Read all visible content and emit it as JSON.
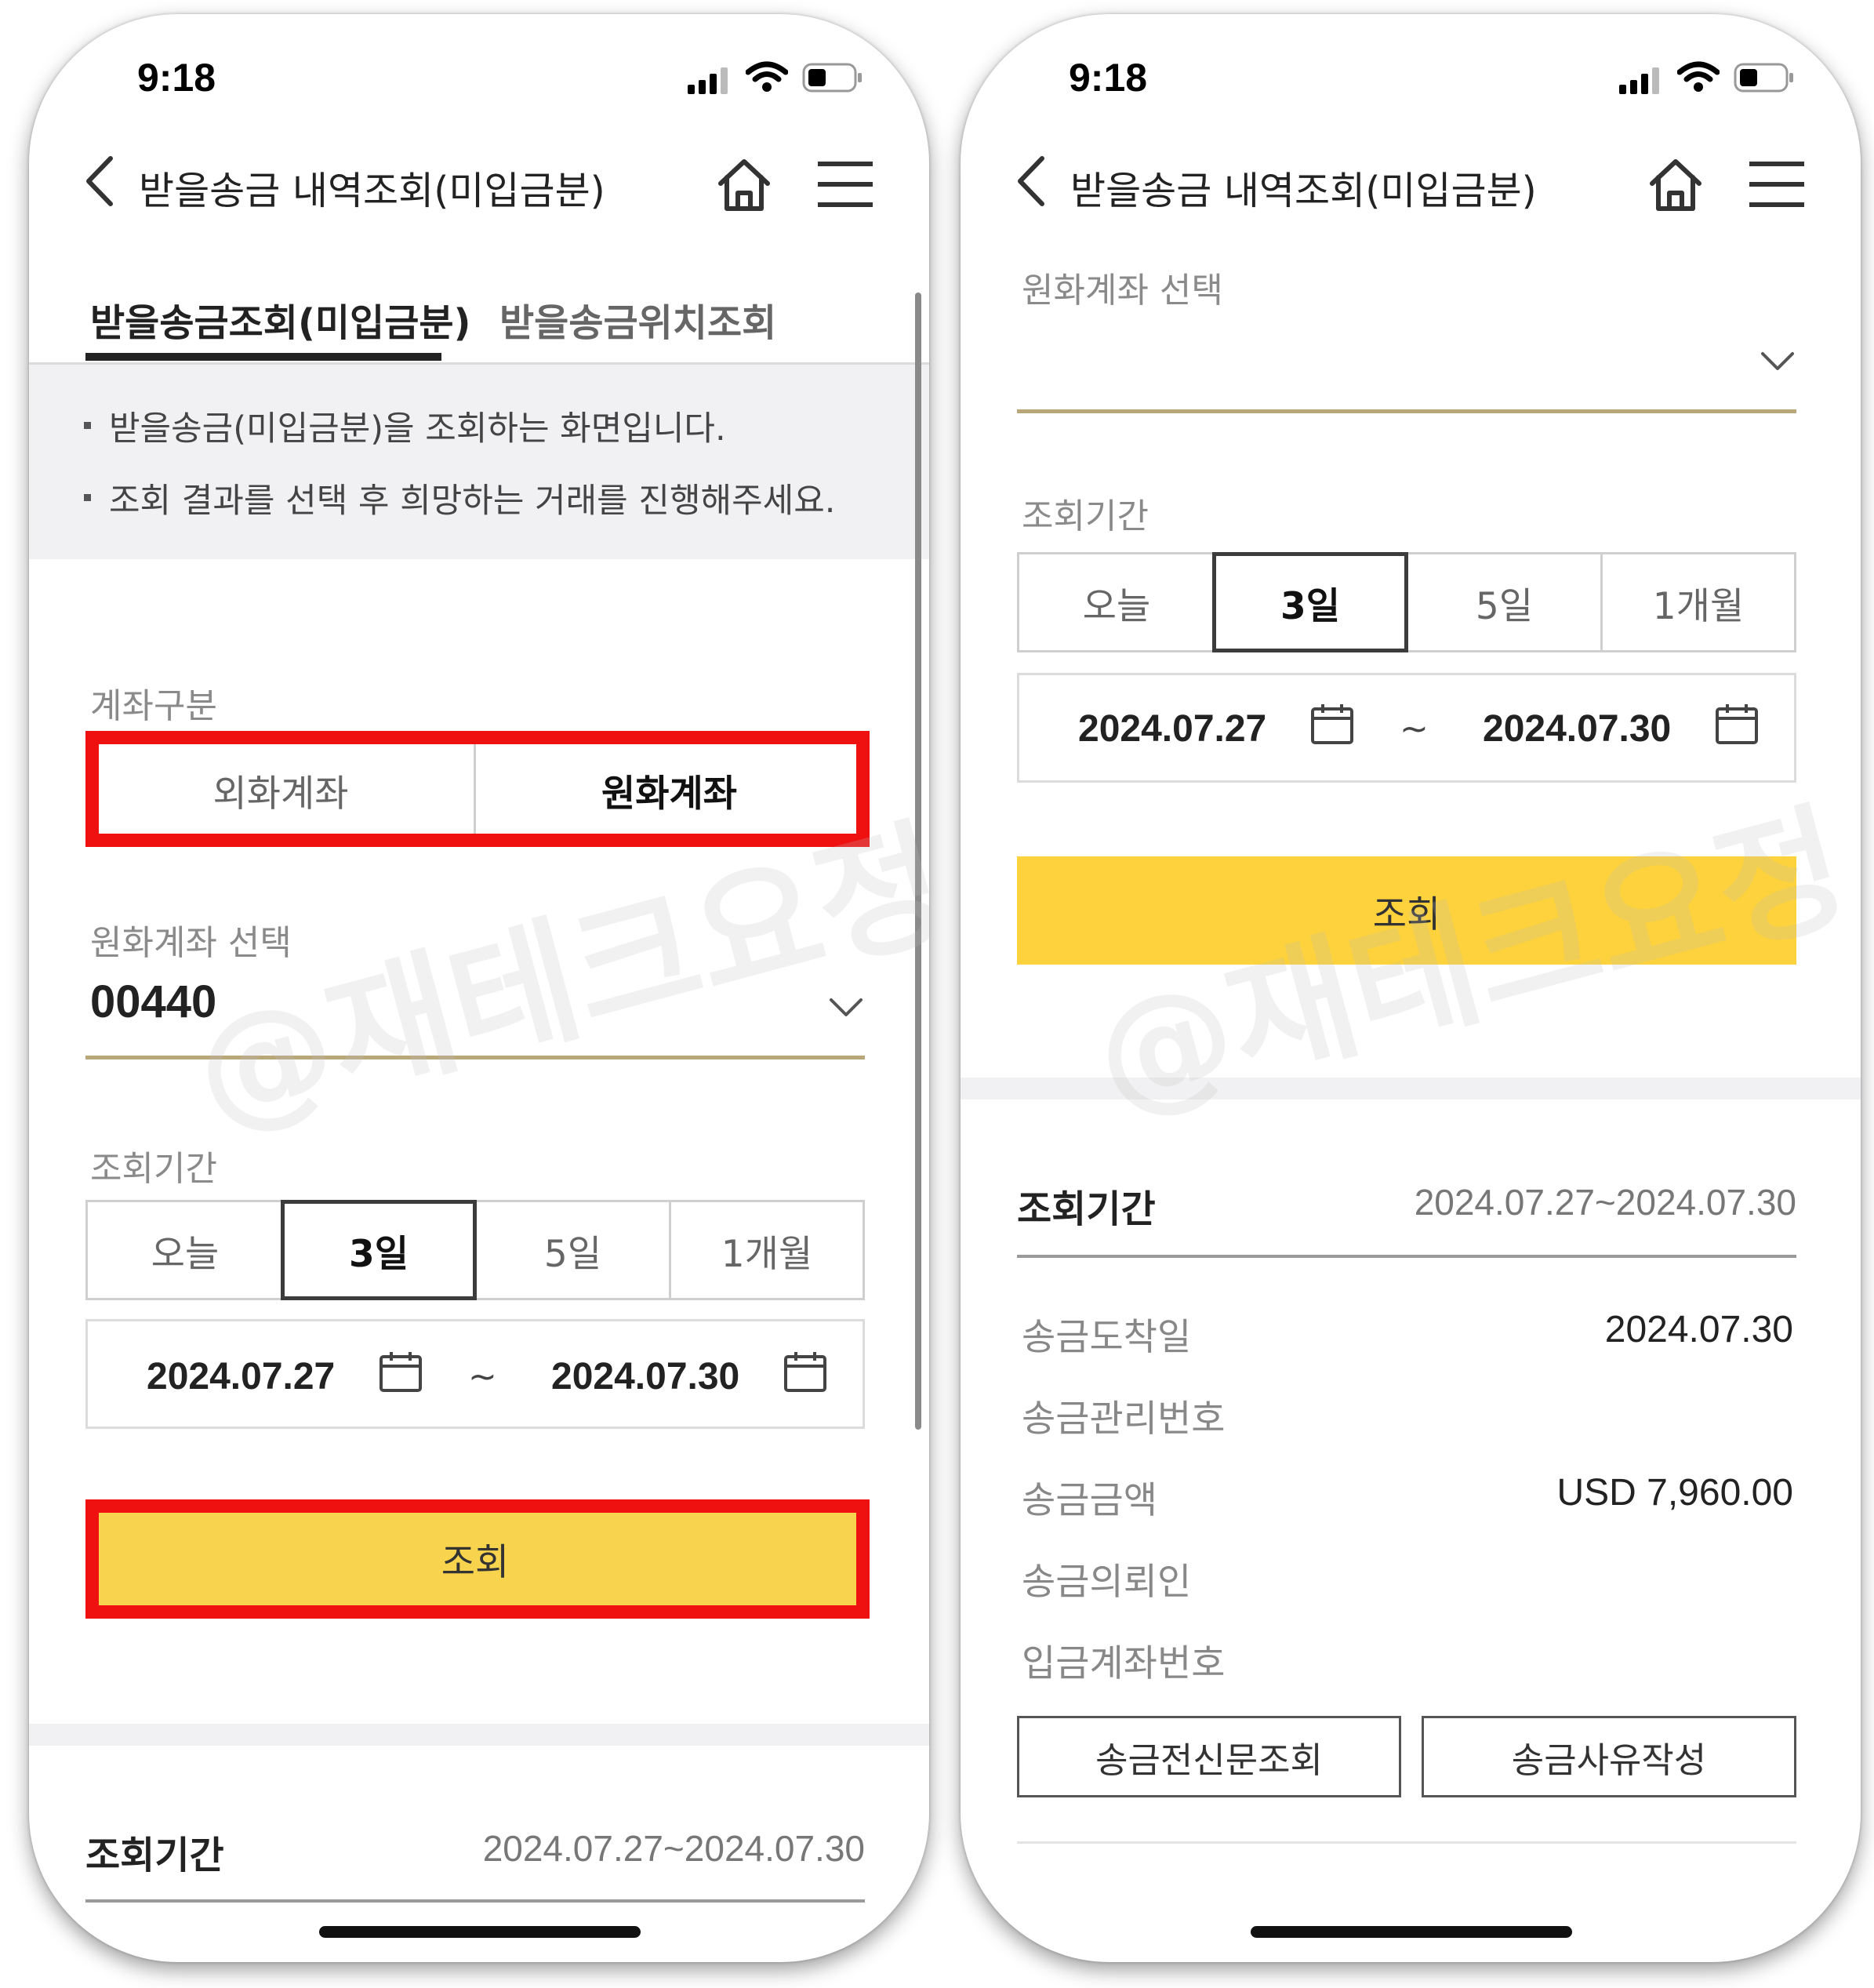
{
  "status_bar": {
    "time": "9:18"
  },
  "header": {
    "title": "받을송금 내역조회(미입금분)"
  },
  "tabs": [
    {
      "label": "받을송금조회(미입금분)",
      "active": true
    },
    {
      "label": "받을송금위치조회",
      "active": false
    }
  ],
  "notice": {
    "lines": [
      "받을송금(미입금분)을 조회하는 화면입니다.",
      "조회 결과를 선택 후 희망하는 거래를 진행해주세요."
    ]
  },
  "account_type": {
    "label": "계좌구분",
    "options": [
      "외화계좌",
      "원화계좌"
    ],
    "selected": "원화계좌"
  },
  "account_select": {
    "label": "원화계좌 선택",
    "value": "00440"
  },
  "period": {
    "label": "조회기간",
    "options": [
      "오늘",
      "3일",
      "5일",
      "1개월"
    ],
    "selected": "3일",
    "start_date": "2024.07.27",
    "tilde": "~",
    "end_date": "2024.07.30"
  },
  "search_button": {
    "label": "조회"
  },
  "result": {
    "period_label": "조회기간",
    "period_value": "2024.07.27~2024.07.30",
    "rows": [
      {
        "label": "송금도착일",
        "value": "2024.07.30"
      },
      {
        "label": "송금관리번호",
        "value": ""
      },
      {
        "label": "송금금액",
        "value": "USD 7,960.00"
      },
      {
        "label": "송금의뢰인",
        "value": ""
      },
      {
        "label": "입금계좌번호",
        "value": ""
      }
    ],
    "buttons": [
      "송금전신문조회",
      "송금사유작성"
    ]
  },
  "watermark": "@재테크요정",
  "colors": {
    "accent_yellow": "#f8d34d",
    "highlight_red": "#ef1010",
    "gold_underline": "#b9a77a"
  },
  "icons": [
    "back-chevron-icon",
    "home-icon",
    "menu-icon",
    "signal-icon",
    "wifi-icon",
    "battery-icon",
    "chevron-down-icon",
    "calendar-icon"
  ]
}
